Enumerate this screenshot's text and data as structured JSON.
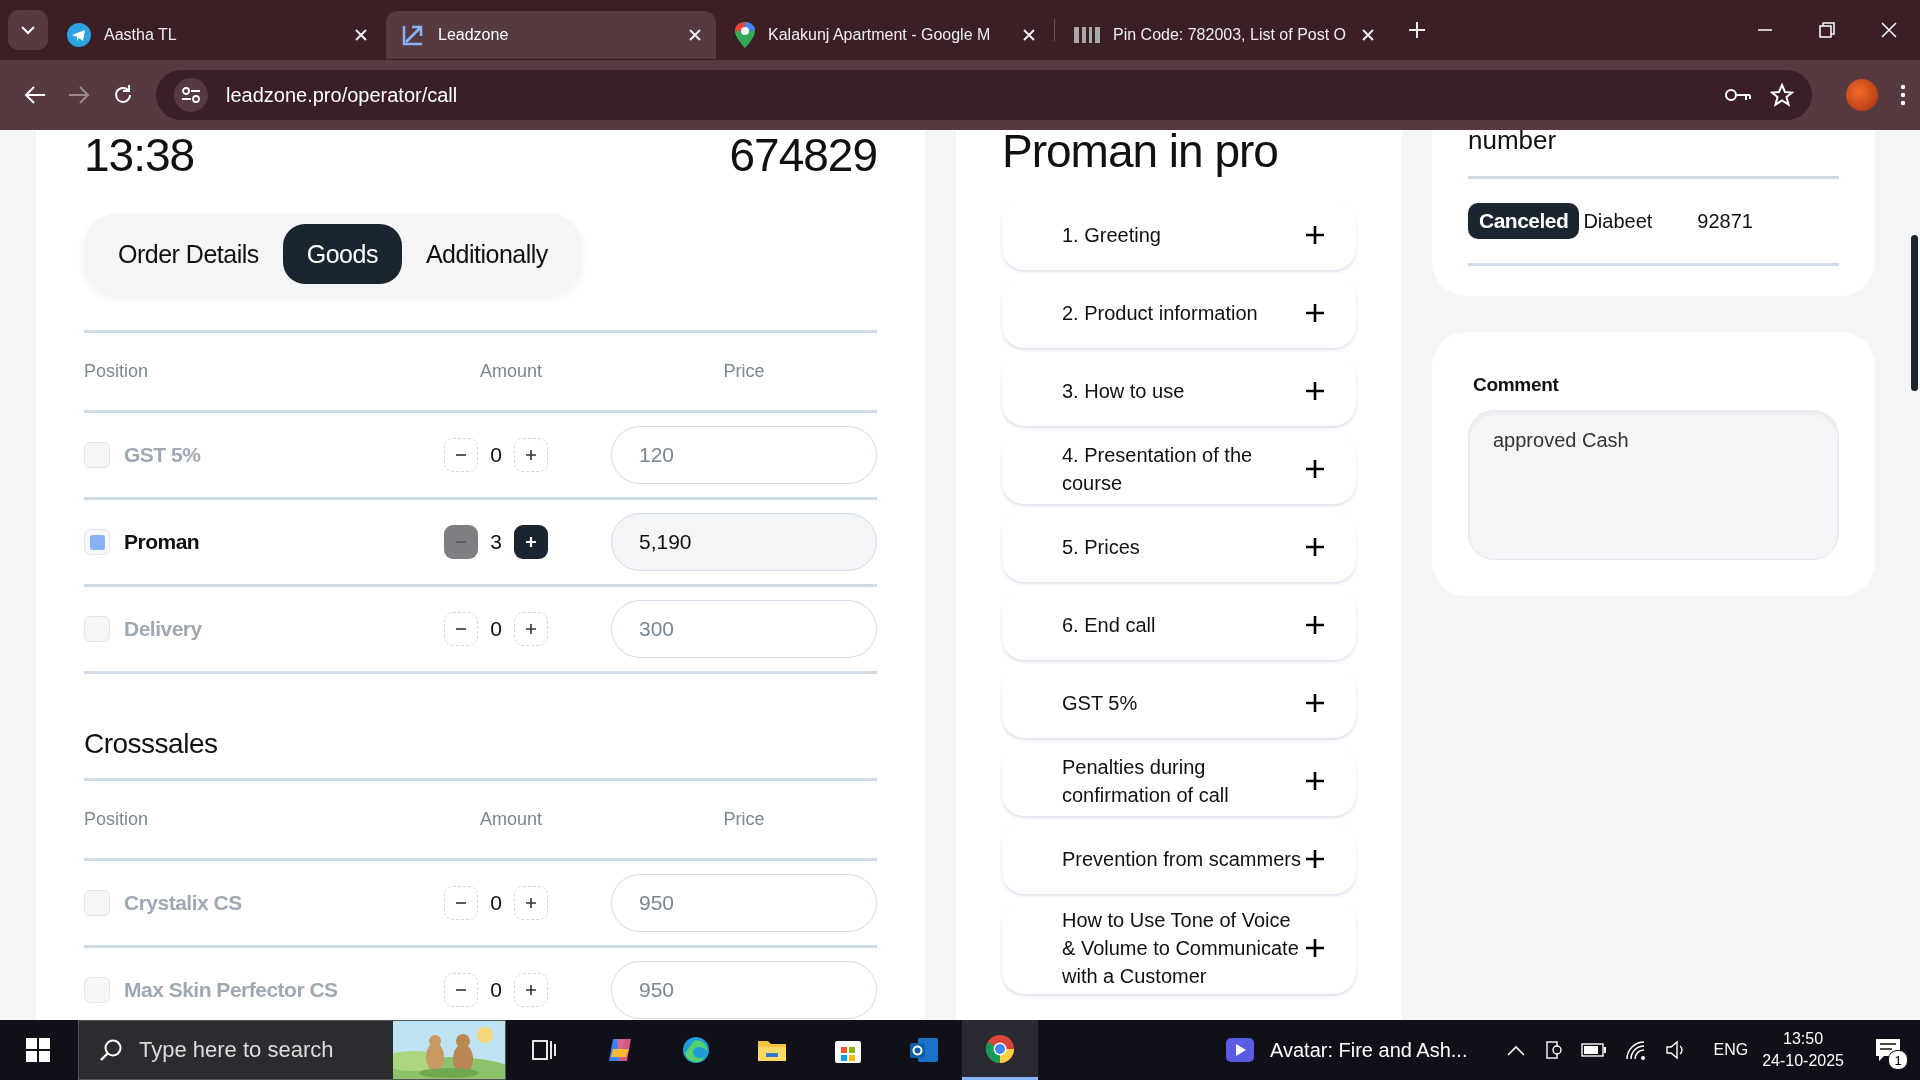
{
  "browser": {
    "tabs": [
      {
        "title": "Aastha TL",
        "kind": "plane",
        "selected": false
      },
      {
        "title": "Leadzone",
        "kind": "arrow",
        "selected": true
      },
      {
        "title": "Kalakunj Apartment - Google M",
        "kind": "marker",
        "selected": false
      },
      {
        "title": "Pin Code: 782003, List of Post O",
        "kind": "bars",
        "selected": false
      }
    ],
    "url": "leadzone.pro/operator/call"
  },
  "order": {
    "time": "13:38",
    "number": "674829",
    "tabs": [
      {
        "label": "Order Details",
        "selected": false
      },
      {
        "label": "Goods",
        "selected": true
      },
      {
        "label": "Additionally",
        "selected": false
      }
    ],
    "goods": {
      "columns": [
        "Position",
        "Amount",
        "Price"
      ],
      "rows": [
        {
          "name": "GST 5%",
          "checked": false,
          "amount": "0",
          "price": "120"
        },
        {
          "name": "Proman",
          "checked": true,
          "amount": "3",
          "price": "5,190"
        },
        {
          "name": "Delivery",
          "checked": false,
          "amount": "0",
          "price": "300"
        }
      ]
    },
    "crosssales": {
      "title": "Crosssales",
      "columns": [
        "Position",
        "Amount",
        "Price"
      ],
      "rows": [
        {
          "name": "Crystalix CS",
          "checked": false,
          "amount": "0",
          "price": "950"
        },
        {
          "name": "Max Skin Perfector CS",
          "checked": false,
          "amount": "0",
          "price": "950"
        }
      ]
    }
  },
  "script": {
    "title": "Proman in pro",
    "items": [
      "1. Greeting",
      "2. Product information",
      "3. How to use",
      "4. Presentation of the course",
      "5. Prices",
      "6. End call",
      "GST 5%",
      "Penalties during confirmation of call",
      "Prevention from scammers",
      "How to Use Tone of Voice & Volume to Communicate with a Customer"
    ]
  },
  "side": {
    "heading": "number",
    "row": {
      "status": "Canceled",
      "column_2": "Diabeet",
      "column_3": "92871"
    },
    "comment": {
      "label": "Comment",
      "value": "approved Cash"
    }
  },
  "taskbar": {
    "search": {
      "placeholder": "Type here to search"
    },
    "apps": [
      {
        "kind": "taskview",
        "active": false
      },
      {
        "kind": "copilot",
        "active": false
      },
      {
        "kind": "edge",
        "active": false
      },
      {
        "kind": "folder",
        "active": false
      },
      {
        "kind": "store",
        "active": false
      },
      {
        "kind": "mail",
        "active": false
      },
      {
        "kind": "chrome",
        "active": true
      }
    ],
    "media": "Avatar: Fire and Ash...",
    "language": "ENG",
    "time": "13:50",
    "date": "24-10-2025",
    "notifications": "1"
  }
}
